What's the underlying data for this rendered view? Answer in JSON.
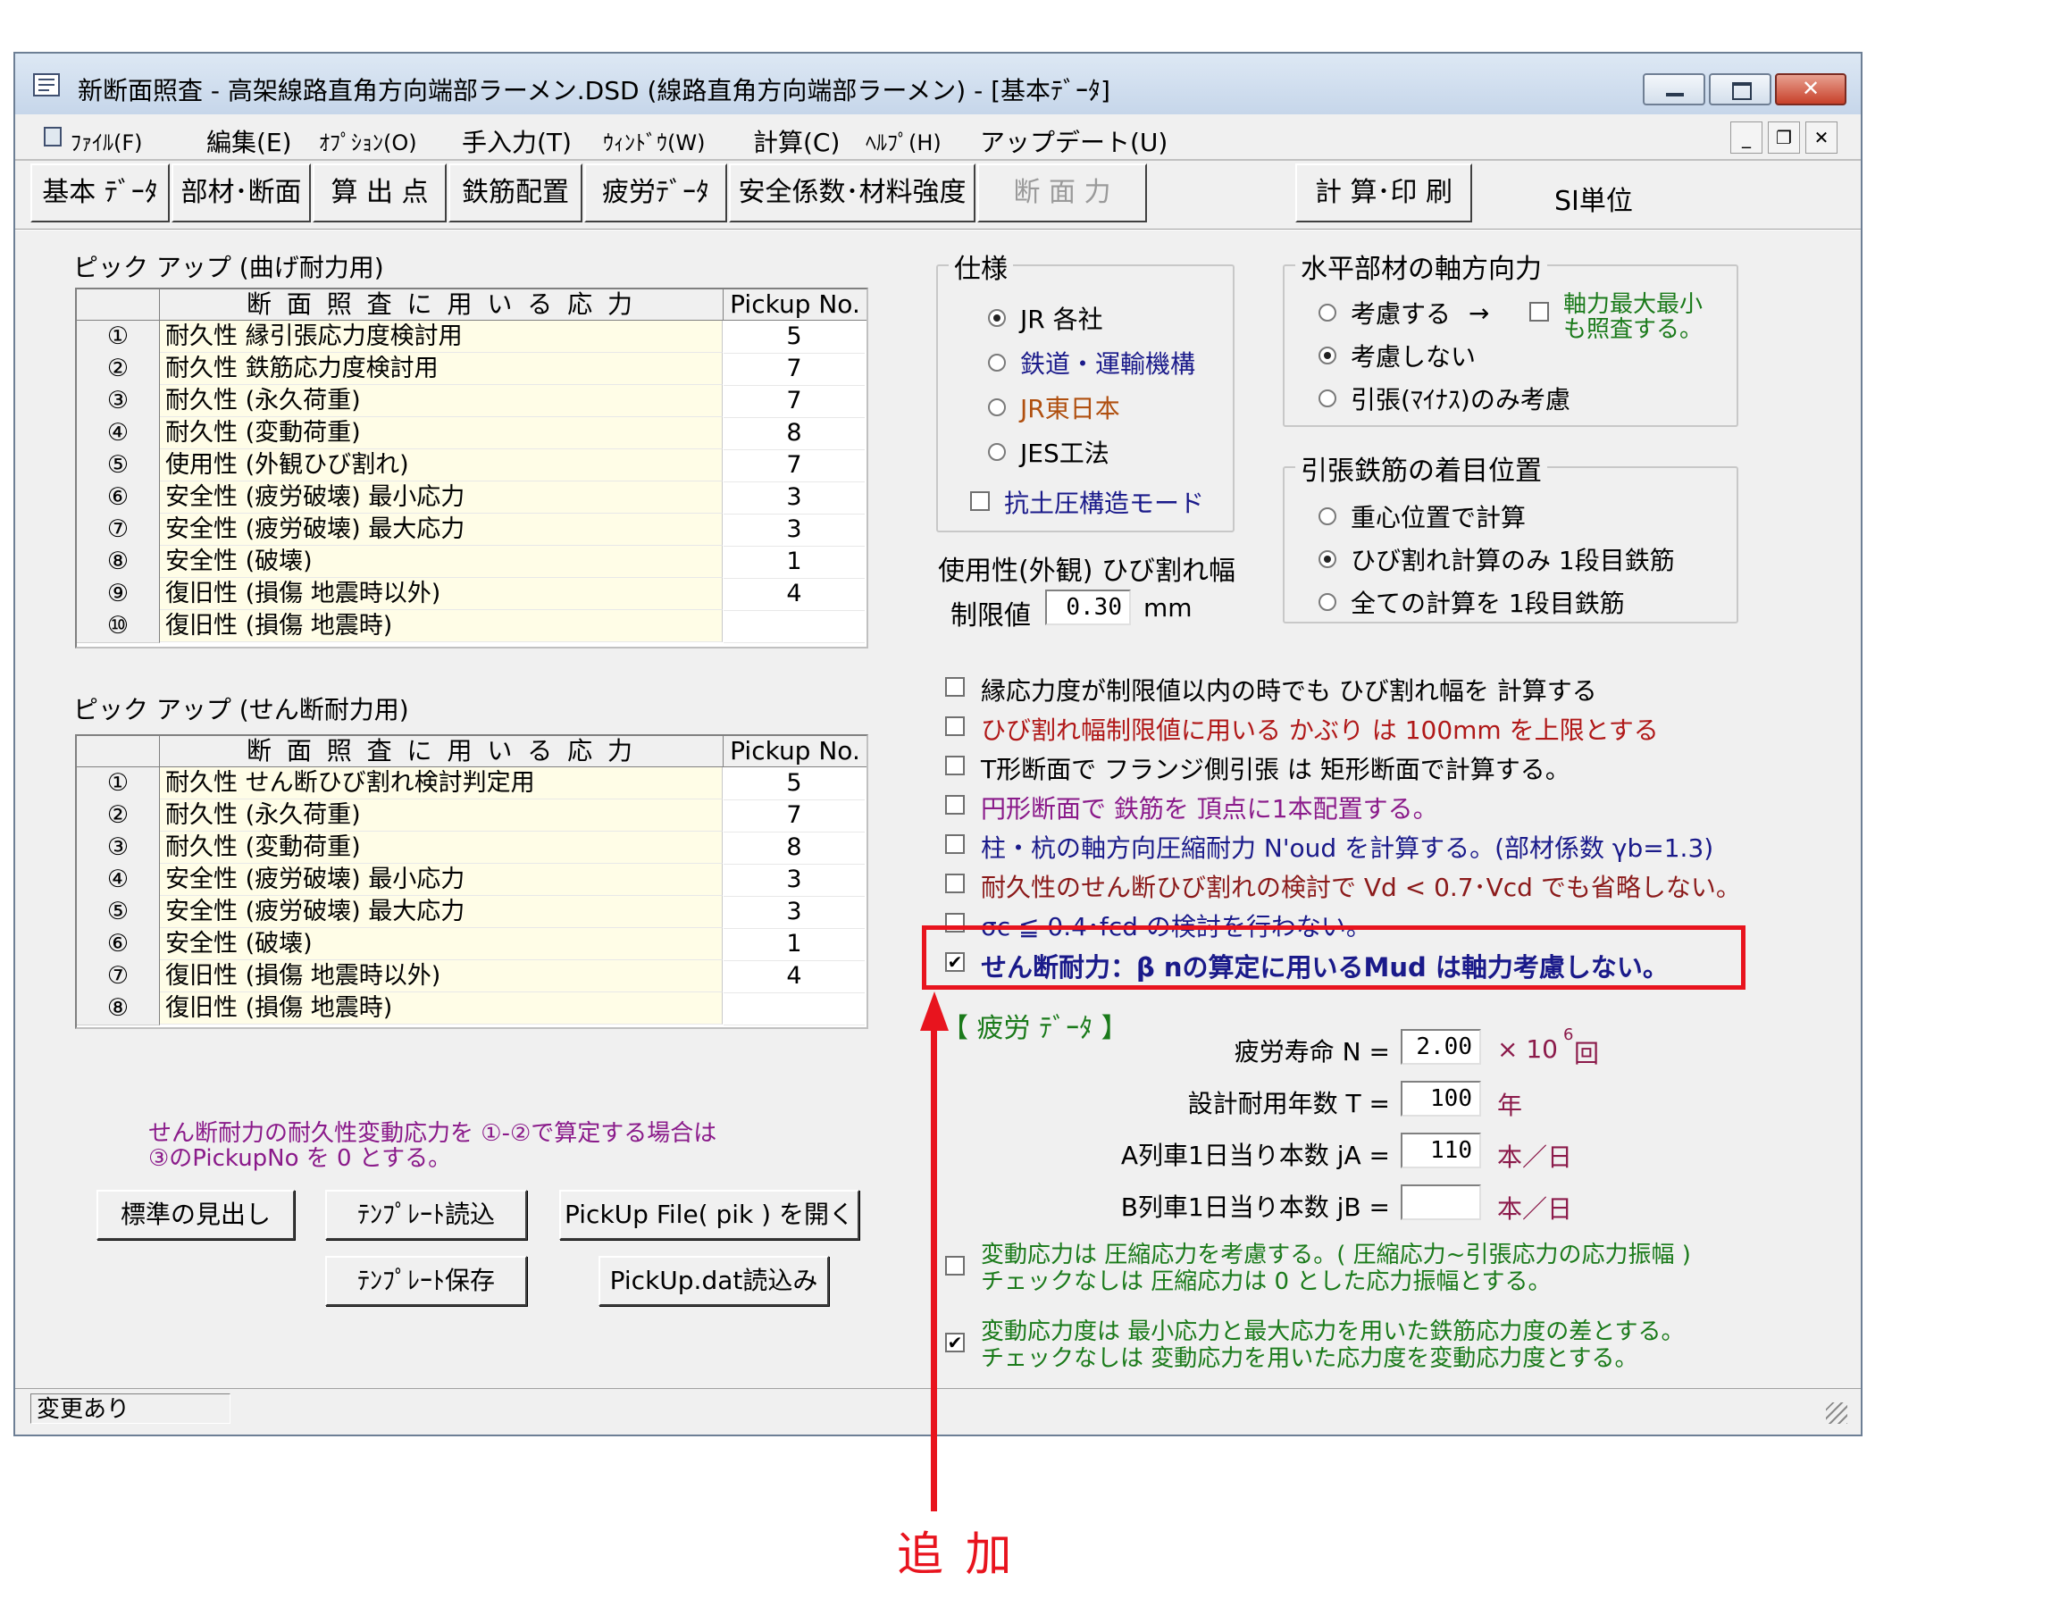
{
  "window": {
    "title": "新断面照査 - 高架線路直角方向端部ラーメン.DSD (線路直角方向端部ラーメン) - [基本ﾃﾞｰﾀ]"
  },
  "menu": [
    "ﾌｧｲﾙ(F)",
    "編集(E)",
    "ｵﾌﾟｼｮﾝ(O)",
    "手入力(T)",
    "ｳｨﾝﾄﾞｳ(W)",
    "計算(C)",
    "ﾍﾙﾌﾟ(H)",
    "アップデート(U)"
  ],
  "tabs": [
    "基本 ﾃﾞｰﾀ",
    "部材･断面",
    "算 出 点",
    "鉄筋配置",
    "疲労ﾃﾞｰﾀ",
    "安全係数･材料強度",
    "断 面 力",
    "計 算･印 刷"
  ],
  "units_label": "SI単位",
  "pickup_bending": {
    "title": "ピック アップ (曲げ耐力用)",
    "col_stress": "断 面 照 査 に 用 い る 応 力",
    "col_no": "Pickup No.",
    "rows": [
      {
        "n": "①",
        "label": "耐久性 縁引張応力度検討用",
        "v": "5"
      },
      {
        "n": "②",
        "label": "耐久性 鉄筋応力度検討用",
        "v": "7"
      },
      {
        "n": "③",
        "label": "耐久性 (永久荷重)",
        "v": "7"
      },
      {
        "n": "④",
        "label": "耐久性 (変動荷重)",
        "v": "8"
      },
      {
        "n": "⑤",
        "label": "使用性 (外観ひび割れ)",
        "v": "7"
      },
      {
        "n": "⑥",
        "label": "安全性 (疲労破壊) 最小応力",
        "v": "3"
      },
      {
        "n": "⑦",
        "label": "安全性 (疲労破壊) 最大応力",
        "v": "3"
      },
      {
        "n": "⑧",
        "label": "安全性 (破壊)",
        "v": "1"
      },
      {
        "n": "⑨",
        "label": "復旧性 (損傷 地震時以外)",
        "v": "4"
      },
      {
        "n": "⑩",
        "label": "復旧性 (損傷 地震時)",
        "v": ""
      }
    ]
  },
  "pickup_shear": {
    "title": "ピック アップ (せん断耐力用)",
    "col_stress": "断 面 照 査 に 用 い る 応 力",
    "col_no": "Pickup No.",
    "rows": [
      {
        "n": "①",
        "label": "耐久性 せん断ひび割れ検討判定用",
        "v": "5"
      },
      {
        "n": "②",
        "label": "耐久性 (永久荷重)",
        "v": "7"
      },
      {
        "n": "③",
        "label": "耐久性 (変動荷重)",
        "v": "8"
      },
      {
        "n": "④",
        "label": "安全性 (疲労破壊) 最小応力",
        "v": "3"
      },
      {
        "n": "⑤",
        "label": "安全性 (疲労破壊) 最大応力",
        "v": "3"
      },
      {
        "n": "⑥",
        "label": "安全性 (破壊)",
        "v": "1"
      },
      {
        "n": "⑦",
        "label": "復旧性 (損傷 地震時以外)",
        "v": "4"
      },
      {
        "n": "⑧",
        "label": "復旧性 (損傷 地震時)",
        "v": ""
      }
    ]
  },
  "note": {
    "line1": "せん断耐力の耐久性変動応力を ①-②で算定する場合は",
    "line2": "③のPickupNo を 0 とする。"
  },
  "buttons": {
    "standard_heading": "標準の見出し",
    "template_load": "ﾃﾝﾌﾟﾚｰﾄ読込",
    "pickup_open": "PickUp File( pik ) を開く",
    "template_save": "ﾃﾝﾌﾟﾚｰﾄ保存",
    "pickup_dat": "PickUp.dat読込み"
  },
  "status": "変更あり",
  "spec": {
    "legend": "仕様",
    "options": [
      "JR 各社",
      "鉄道・運輸機構",
      "JR東日本",
      "JES工法"
    ],
    "selected": 0,
    "earth_pressure": "抗土圧構造モード"
  },
  "crack": {
    "title": "使用性(外観) ひび割れ幅",
    "limit_label": "制限値",
    "limit_value": "0.30",
    "unit": "mm"
  },
  "axial": {
    "legend": "水平部材の軸方向力",
    "options": [
      "考慮する",
      "考慮しない",
      "引張(ﾏｲﾅｽ)のみ考慮"
    ],
    "selected": 1,
    "arrow": "→",
    "check_line1": "軸力最大最小",
    "check_line2": "も照査する。"
  },
  "rebar_pos": {
    "legend": "引張鉄筋の着目位置",
    "options": [
      "重心位置で計算",
      "ひび割れ計算のみ 1段目鉄筋",
      "全ての計算を 1段目鉄筋"
    ],
    "selected": 1
  },
  "checks": [
    {
      "label": "縁応力度が制限値以内の時でも ひび割れ幅を 計算する",
      "checked": false,
      "color": "#000000"
    },
    {
      "label": "ひび割れ幅制限値に用いる かぶり は 100mm を上限とする",
      "checked": false,
      "color": "#b01818"
    },
    {
      "label": "T形断面で フランジ側引張 は 矩形断面で計算する。",
      "checked": false,
      "color": "#000000"
    },
    {
      "label": "円形断面で 鉄筋を 頂点に1本配置する。",
      "checked": false,
      "color": "#8a1a8a"
    },
    {
      "label": "柱・杭の軸方向圧縮耐力 N'oud を計算する。(部材係数 γb=1.3)",
      "checked": false,
      "color": "#1a1a8a"
    },
    {
      "label": "耐久性のせん断ひび割れの検討で Vd < 0.7･Vcd でも省略しない。",
      "checked": false,
      "color": "#8b1a1a"
    },
    {
      "label": "σc ≦ 0.4･fcd の検討を行わない。",
      "checked": false,
      "color": "#1a1a8a"
    },
    {
      "label": "せん断耐力：β nの算定に用いるMud は軸力考慮しない。",
      "checked": true,
      "color": "#1a1a8a"
    }
  ],
  "fatigue": {
    "title": "【 疲労 ﾃﾞｰﾀ 】",
    "rows": [
      {
        "label": "疲労寿命  N =",
        "value": "2.00",
        "unit": "× 10",
        "sup": "6",
        "unit2": " 回"
      },
      {
        "label": "設計耐用年数 T =",
        "value": "100",
        "unit": "年",
        "sup": "",
        "unit2": ""
      },
      {
        "label": "A列車1日当り本数  jA =",
        "value": "110",
        "unit": "本／日",
        "sup": "",
        "unit2": ""
      },
      {
        "label": "B列車1日当り本数  jB =",
        "value": "",
        "unit": "本／日",
        "sup": "",
        "unit2": ""
      }
    ]
  },
  "var_checks": [
    {
      "line1": "変動応力は 圧縮応力を考慮する。( 圧縮応力~引張応力の応力振幅 )",
      "line2": "チェックなしは 圧縮応力は 0 とした応力振幅とする。",
      "checked": false
    },
    {
      "line1": "変動応力度は 最小応力と最大応力を用いた鉄筋応力度の差とする。",
      "line2": "チェックなしは 変動応力を用いた応力度を変動応力度とする。",
      "checked": true
    }
  ],
  "annotation": {
    "label": "追 加",
    "color": "#e8141e"
  }
}
